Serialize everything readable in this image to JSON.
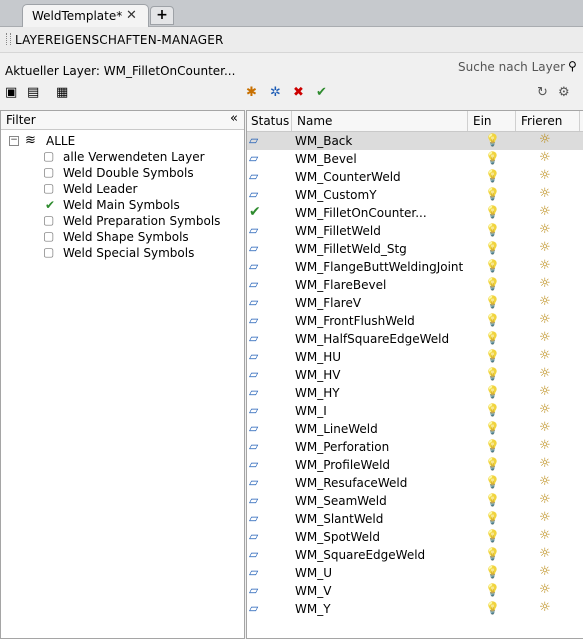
{
  "tab": {
    "title": "WeldTemplate*",
    "close": "✕",
    "add": "+"
  },
  "panel": {
    "title": "LAYEREIGENSCHAFTEN-MANAGER"
  },
  "current_layer": "Aktueller Layer: WM_FilletOnCounter...",
  "search": {
    "placeholder": "Suche nach Layer"
  },
  "filter": {
    "header": "Filter",
    "collapse": "«",
    "root_toggle": "−",
    "root": "ALLE",
    "items": [
      {
        "label": "alle Verwendeten Layer",
        "active": false
      },
      {
        "label": "Weld Double Symbols",
        "active": false
      },
      {
        "label": "Weld Leader",
        "active": false
      },
      {
        "label": "Weld Main Symbols",
        "active": true
      },
      {
        "label": "Weld Preparation Symbols",
        "active": false
      },
      {
        "label": "Weld Shape Symbols",
        "active": false
      },
      {
        "label": "Weld Special Symbols",
        "active": false
      }
    ]
  },
  "columns": {
    "status": "Status",
    "name": "Name",
    "on": "Ein",
    "freeze": "Frieren"
  },
  "layers": [
    {
      "name": "WM_Back",
      "current": false
    },
    {
      "name": "WM_Bevel",
      "current": false
    },
    {
      "name": "WM_CounterWeld",
      "current": false
    },
    {
      "name": "WM_CustomY",
      "current": false
    },
    {
      "name": "WM_FilletOnCounter...",
      "current": true
    },
    {
      "name": "WM_FilletWeld",
      "current": false
    },
    {
      "name": "WM_FilletWeld_Stg",
      "current": false
    },
    {
      "name": "WM_FlangeButtWeldingJoint",
      "current": false
    },
    {
      "name": "WM_FlareBevel",
      "current": false
    },
    {
      "name": "WM_FlareV",
      "current": false
    },
    {
      "name": "WM_FrontFlushWeld",
      "current": false
    },
    {
      "name": "WM_HalfSquareEdgeWeld",
      "current": false
    },
    {
      "name": "WM_HU",
      "current": false
    },
    {
      "name": "WM_HV",
      "current": false
    },
    {
      "name": "WM_HY",
      "current": false
    },
    {
      "name": "WM_I",
      "current": false
    },
    {
      "name": "WM_LineWeld",
      "current": false
    },
    {
      "name": "WM_Perforation",
      "current": false
    },
    {
      "name": "WM_ProfileWeld",
      "current": false
    },
    {
      "name": "WM_ResufaceWeld",
      "current": false
    },
    {
      "name": "WM_SeamWeld",
      "current": false
    },
    {
      "name": "WM_SlantWeld",
      "current": false
    },
    {
      "name": "WM_SpotWeld",
      "current": false
    },
    {
      "name": "WM_SquareEdgeWeld",
      "current": false
    },
    {
      "name": "WM_U",
      "current": false
    },
    {
      "name": "WM_V",
      "current": false
    },
    {
      "name": "WM_Y",
      "current": false
    }
  ],
  "icons": {
    "layer_status": "parallelogram-icon",
    "current_check": "checkmark-icon",
    "on": "bulb-icon",
    "freeze": "sun-icon"
  }
}
